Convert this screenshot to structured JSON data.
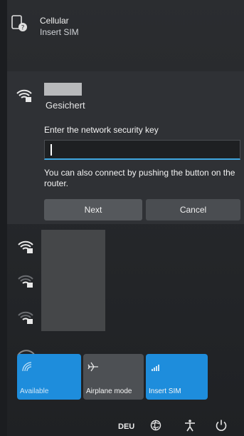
{
  "cellular": {
    "title": "Cellular",
    "status": "Insert SIM",
    "icon": "cellular-no-sim-icon"
  },
  "network": {
    "security": "Gesichert",
    "key_label": "Enter the network security key",
    "key_value": "",
    "hint": "You can also connect by pushing the button on the router.",
    "next_label": "Next",
    "cancel_label": "Cancel",
    "icon": "wifi-lock-icon"
  },
  "other_networks": {
    "icons": [
      "wifi-lock-icon",
      "wifi-lock-icon",
      "wifi-lock-icon"
    ]
  },
  "quick_settings": [
    {
      "label": "Available",
      "icon": "wifi-icon",
      "active": true
    },
    {
      "label": "Airplane mode",
      "icon": "airplane-icon",
      "active": false
    },
    {
      "label": "Insert SIM",
      "icon": "cellular-signal-icon",
      "active": true
    }
  ],
  "taskbar": {
    "language": "DEU",
    "icons": [
      "network-settings-icon",
      "accessibility-icon",
      "power-icon"
    ]
  },
  "colors": {
    "accent": "#1e8ddc",
    "focus_underline": "#3fa7e0",
    "panel": "#2b2d30"
  }
}
